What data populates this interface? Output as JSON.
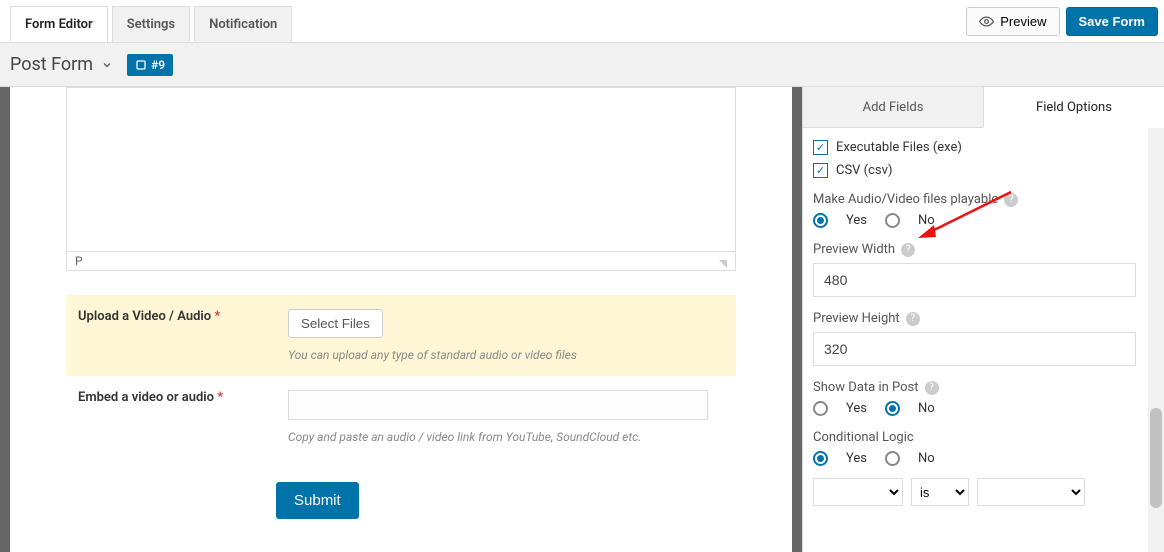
{
  "top_tabs": {
    "editor": "Form Editor",
    "settings": "Settings",
    "notification": "Notification"
  },
  "top_actions": {
    "preview": "Preview",
    "save": "Save Form"
  },
  "header": {
    "title": "Post Form",
    "id_chip": "#9"
  },
  "canvas": {
    "rich_status": "P",
    "upload": {
      "label": "Upload a Video / Audio",
      "button": "Select Files",
      "hint": "You can upload any type of standard audio or video files"
    },
    "embed": {
      "label": "Embed a video or audio",
      "hint": "Copy and paste an audio / video link from YouTube, SoundCloud etc."
    },
    "submit": "Submit"
  },
  "sidebar": {
    "tab_add": "Add Fields",
    "tab_options": "Field Options",
    "check_exe": "Executable Files (exe)",
    "check_csv": "CSV (csv)",
    "playable": {
      "label": "Make Audio/Video files playable",
      "yes": "Yes",
      "no": "No"
    },
    "preview_width": {
      "label": "Preview Width",
      "value": "480"
    },
    "preview_height": {
      "label": "Preview Height",
      "value": "320"
    },
    "show_in_post": {
      "label": "Show Data in Post",
      "yes": "Yes",
      "no": "No"
    },
    "cond": {
      "label": "Conditional Logic",
      "yes": "Yes",
      "no": "No",
      "op": "is"
    }
  }
}
